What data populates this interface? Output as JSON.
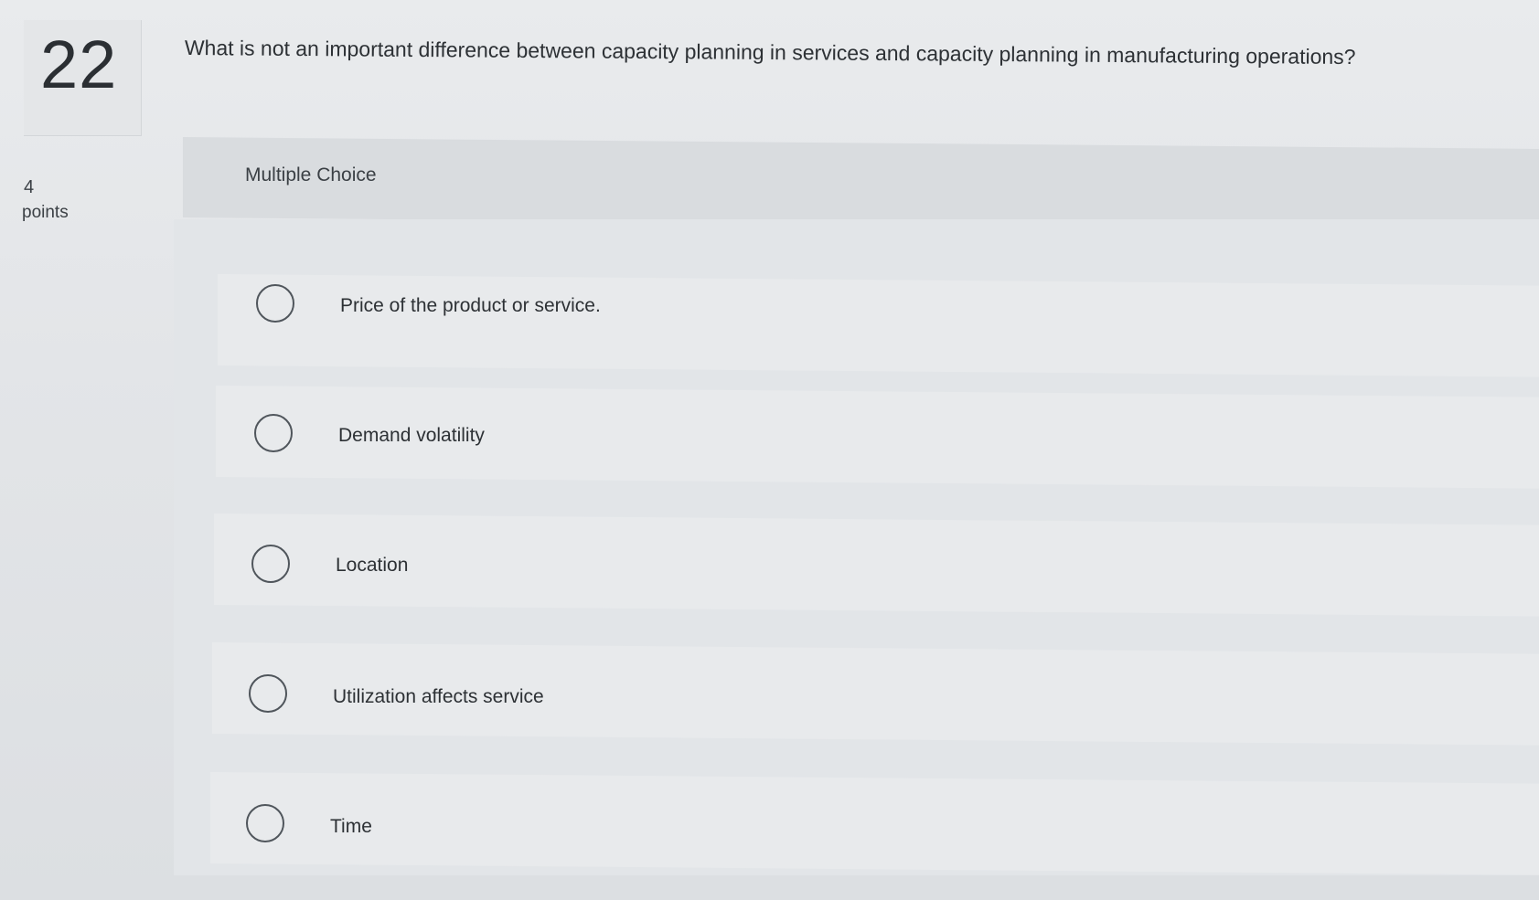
{
  "question": {
    "number": "22",
    "points_value": "4",
    "points_label": "points",
    "text": "What is not an important difference between capacity planning in services and capacity planning in manufacturing operations?"
  },
  "question_type": "Multiple Choice",
  "options": [
    {
      "label": "Price of the product or service."
    },
    {
      "label": "Demand volatility"
    },
    {
      "label": "Location"
    },
    {
      "label": "Utilization affects service"
    },
    {
      "label": "Time"
    }
  ],
  "colors": {
    "background": "#e3e5e8",
    "header_band": "#d9dcdf",
    "text": "#2d3135",
    "radio_border": "#50565c"
  }
}
